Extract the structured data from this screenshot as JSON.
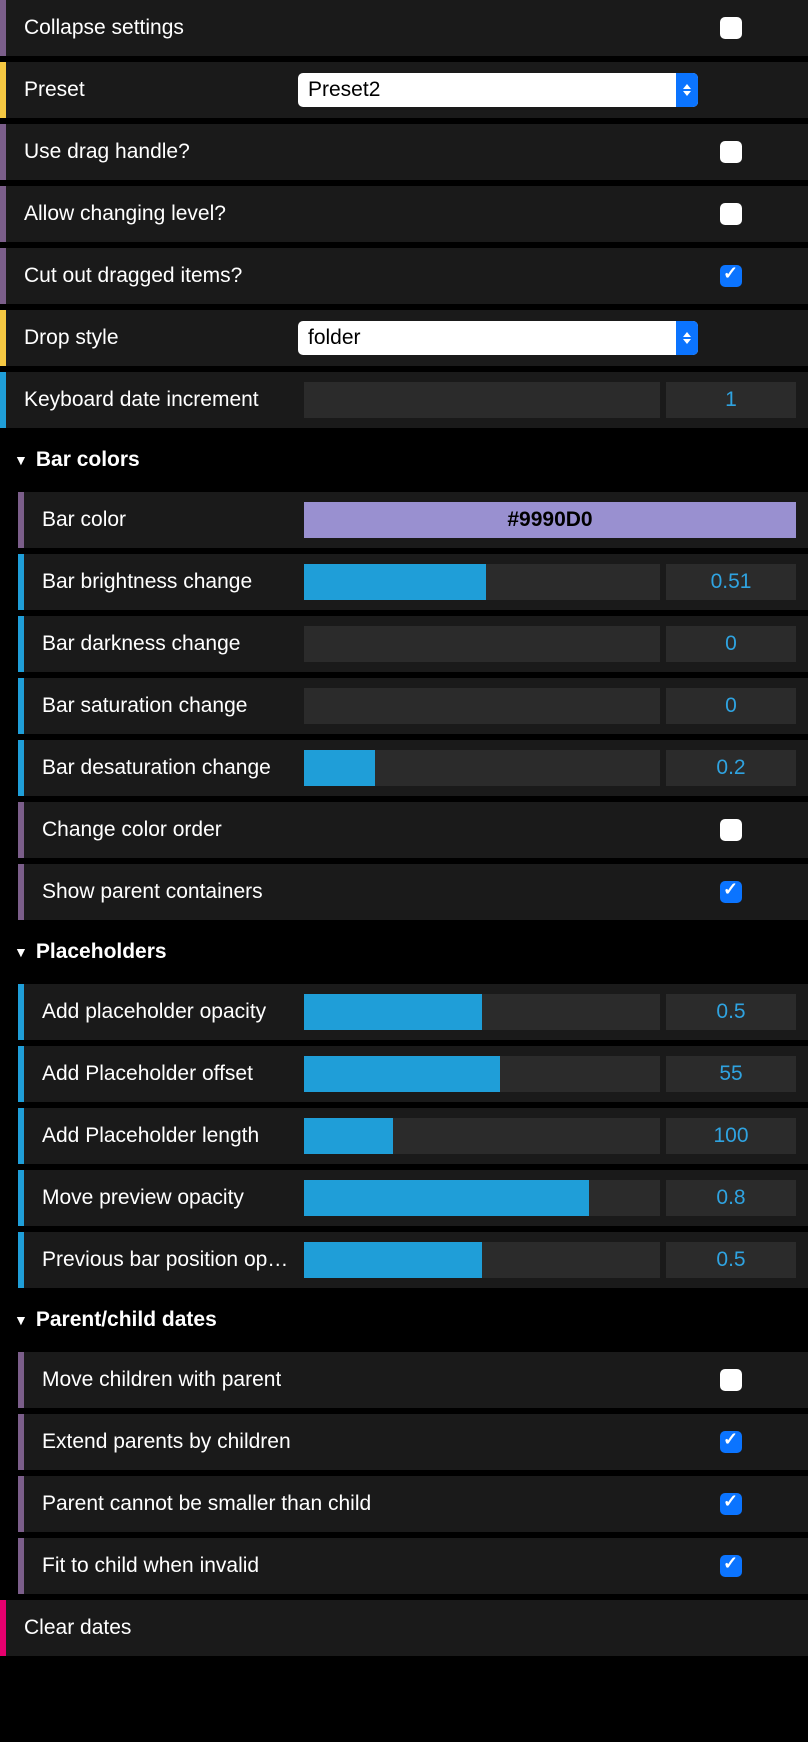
{
  "top": {
    "collapse_settings": {
      "label": "Collapse settings",
      "checked": false,
      "accent": "purple"
    },
    "preset": {
      "label": "Preset",
      "value": "Preset2",
      "accent": "yellow"
    },
    "use_drag_handle": {
      "label": "Use drag handle?",
      "checked": false,
      "accent": "purple"
    },
    "allow_changing_level": {
      "label": "Allow changing level?",
      "checked": false,
      "accent": "purple"
    },
    "cut_out_dragged": {
      "label": "Cut out dragged items?",
      "checked": true,
      "accent": "purple"
    },
    "drop_style": {
      "label": "Drop style",
      "value": "folder",
      "accent": "yellow"
    },
    "keyboard_date_increment": {
      "label": "Keyboard date increment",
      "value": "1",
      "accent": "blue"
    }
  },
  "bar_colors": {
    "header": "Bar colors",
    "bar_color": {
      "label": "Bar color",
      "value": "#9990D0",
      "accent": "purple"
    },
    "brightness": {
      "label": "Bar brightness change",
      "value": "0.51",
      "fill": 51,
      "accent": "blue"
    },
    "darkness": {
      "label": "Bar darkness change",
      "value": "0",
      "fill": 0,
      "accent": "blue"
    },
    "saturation": {
      "label": "Bar saturation change",
      "value": "0",
      "fill": 0,
      "accent": "blue"
    },
    "desaturation": {
      "label": "Bar desaturation change",
      "value": "0.2",
      "fill": 20,
      "accent": "blue"
    },
    "change_color_order": {
      "label": "Change color order",
      "checked": false,
      "accent": "purple"
    },
    "show_parent_containers": {
      "label": "Show parent containers",
      "checked": true,
      "accent": "purple"
    }
  },
  "placeholders": {
    "header": "Placeholders",
    "opacity": {
      "label": "Add placeholder opacity",
      "value": "0.5",
      "fill": 50,
      "accent": "blue"
    },
    "offset": {
      "label": "Add Placeholder offset",
      "value": "55",
      "fill": 55,
      "accent": "blue"
    },
    "length": {
      "label": "Add Placeholder length",
      "value": "100",
      "fill": 25,
      "accent": "blue"
    },
    "move_preview_opacity": {
      "label": "Move preview opacity",
      "value": "0.8",
      "fill": 80,
      "accent": "blue"
    },
    "prev_bar_pos_opacity": {
      "label": "Previous bar position op…",
      "value": "0.5",
      "fill": 50,
      "accent": "blue"
    }
  },
  "parent_child": {
    "header": "Parent/child dates",
    "move_children": {
      "label": "Move children with parent",
      "checked": false,
      "accent": "purple"
    },
    "extend_parents": {
      "label": "Extend parents by children",
      "checked": true,
      "accent": "purple"
    },
    "parent_not_smaller": {
      "label": "Parent cannot be smaller than child",
      "checked": true,
      "accent": "purple"
    },
    "fit_to_child": {
      "label": "Fit to child when invalid",
      "checked": true,
      "accent": "purple"
    }
  },
  "bottom": {
    "clear_dates": {
      "label": "Clear dates",
      "accent": "red"
    }
  }
}
